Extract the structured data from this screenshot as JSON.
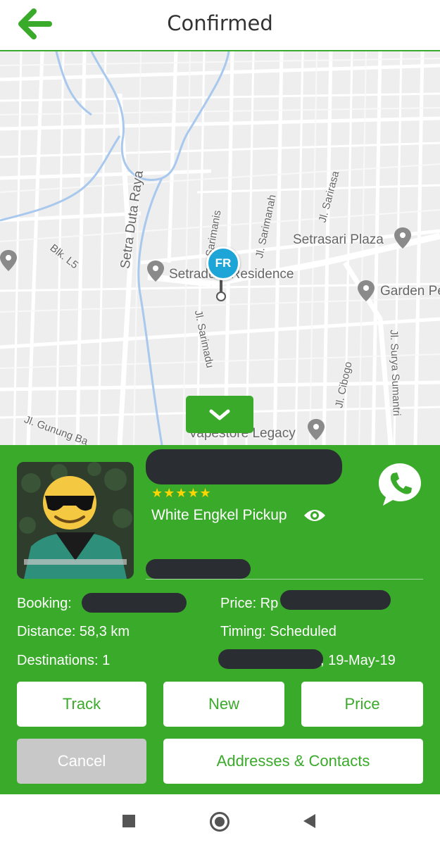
{
  "header": {
    "title": "Confirmed"
  },
  "map": {
    "labels": {
      "setra_duta_raya": "Setra Duta Raya",
      "blk_l5": "Blk. L5",
      "setraduta_residence": "Setraduta Residence",
      "jl_sarimanah": "Jl. Sarimanah",
      "jl_sarirasa": "Jl. Sarirasa",
      "setrasari_plaza": "Setrasari Plaza",
      "garden_p": "Garden Pe",
      "jl_sarimadu": "Jl. Sarimadu",
      "jl_cibogo": "Jl. Cibogo",
      "jl_surya_sumantri": "Jl. Surya Sumantri",
      "jl_gunung_ba": "Jl. Gunung Ba",
      "vapestore_legacy": "Vapestore Legacy",
      "sarimanis": "Sarimanis"
    },
    "pin_initials": "FR"
  },
  "driver": {
    "stars": "★★★★★",
    "vehicle": "White Engkel Pickup"
  },
  "booking": {
    "booking_label": "Booking:",
    "price_label": "Price: Rp",
    "distance": "Distance: 58,3 km",
    "timing": "Timing: Scheduled",
    "destinations": "Destinations: 1",
    "date": ", 19-May-19"
  },
  "actions": {
    "track": "Track",
    "new": "New",
    "price": "Price",
    "cancel": "Cancel",
    "addresses": "Addresses & Contacts"
  },
  "colors": {
    "brand_green": "#3aaa2a",
    "pin_blue": "#1ea5d8",
    "redaction": "#2a2e33"
  }
}
